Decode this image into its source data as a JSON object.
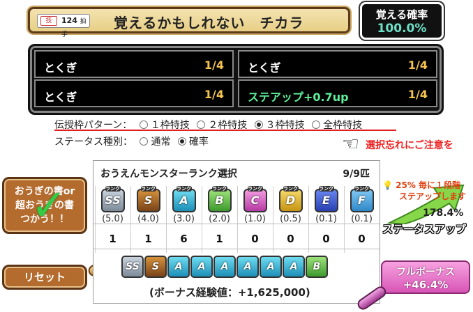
{
  "header": {
    "skill_chip_mark": "技",
    "skill_chip_count": "124",
    "skill_chip_unit": "拍手",
    "title": "覚えるかもしれない　チカラ",
    "prob_label": "覚える確率",
    "prob_value": "100.0%"
  },
  "skills": [
    {
      "name": "とくぎ",
      "frac": "1/4"
    },
    {
      "name": "とくぎ",
      "frac": "1/4"
    },
    {
      "name": "とくぎ",
      "frac": "1/4"
    },
    {
      "name": "ステアップ+0.7up",
      "frac": "1/4"
    }
  ],
  "pattern": {
    "label": "伝授枠パターン：",
    "options": [
      "１枠特技",
      "２枠特技",
      "３枠特技",
      "全枠特技"
    ],
    "selected": "３枠特技"
  },
  "status": {
    "label": "ステータス種別：",
    "options": [
      "通常",
      "確率"
    ],
    "selected": "確率"
  },
  "warning": "選択忘れにご注意を",
  "rank_table": {
    "title": "おうえんモンスターランク選択",
    "count": "9/9匹",
    "tag": "ランク",
    "ranks": [
      {
        "label": "SS",
        "mult": "(5.0)",
        "qty": "1",
        "color": "#9aa6b4"
      },
      {
        "label": "S",
        "mult": "(4.0)",
        "qty": "1",
        "color": "#b8692a"
      },
      {
        "label": "A",
        "mult": "(3.0)",
        "qty": "6",
        "color": "#3bbbe0"
      },
      {
        "label": "B",
        "mult": "(2.0)",
        "qty": "1",
        "color": "#62c34a"
      },
      {
        "label": "C",
        "mult": "(1.0)",
        "qty": "0",
        "color": "#e06cc8"
      },
      {
        "label": "D",
        "mult": "(0.5)",
        "qty": "0",
        "color": "#e9b830"
      },
      {
        "label": "E",
        "mult": "(0.1)",
        "qty": "0",
        "color": "#4560d8"
      },
      {
        "label": "F",
        "mult": "(0.1)",
        "qty": "0",
        "color": "#4aa8e4"
      }
    ],
    "selected": [
      "SS",
      "S",
      "A",
      "A",
      "A",
      "A",
      "A",
      "A",
      "B"
    ],
    "bonus_exp": "(ボーナス経験値：+1,625,000)"
  },
  "left": {
    "book_line1": "おうぎの書or",
    "book_line2": "超おうぎの書",
    "book_line3": "つかう！！",
    "reset": "リセット"
  },
  "right": {
    "step_line1": "25% 毎に１段階",
    "step_line2": "ステアップします",
    "up_percent": "178.4%",
    "status_up": "ステータスアップ",
    "full_bonus_label": "フルボーナス",
    "full_bonus_value": "+46.4%"
  }
}
